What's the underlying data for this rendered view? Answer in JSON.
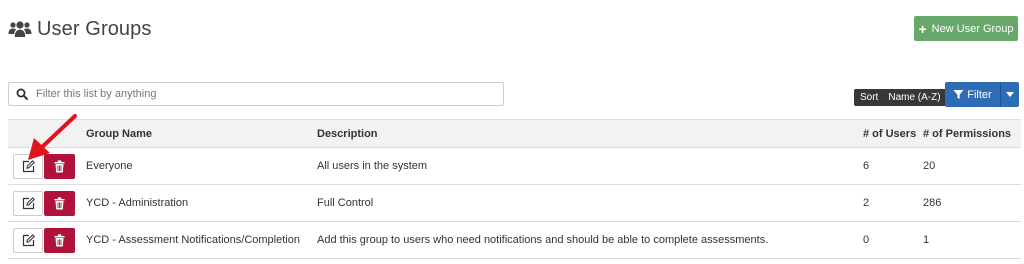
{
  "header": {
    "title": "User Groups",
    "new_button_label": "New User Group"
  },
  "search": {
    "placeholder": "Filter this list by anything"
  },
  "sort": {
    "label": "Sort",
    "value": "Name (A-Z)"
  },
  "filter": {
    "label": "Filter"
  },
  "table": {
    "columns": {
      "name": "Group Name",
      "description": "Description",
      "users": "# of Users",
      "permissions": "# of Permissions"
    },
    "rows": [
      {
        "name": "Everyone",
        "description": "All users in the system",
        "users": "6",
        "permissions": "20"
      },
      {
        "name": "YCD - Administration",
        "description": "Full Control",
        "users": "2",
        "permissions": "286"
      },
      {
        "name": "YCD - Assessment Notifications/Completion",
        "description": "Add this group to users who need notifications and should be able to complete assessments.",
        "users": "0",
        "permissions": "1"
      }
    ]
  },
  "colors": {
    "new_button": "#68a86b",
    "filter_button": "#2e6cb5",
    "delete_button": "#b0123c",
    "annotation_arrow": "#e0141e"
  },
  "icons": [
    "users-icon",
    "plus-icon",
    "search-icon",
    "filter-funnel-icon",
    "caret-down-icon",
    "edit-icon",
    "trash-icon",
    "annotation-arrow"
  ]
}
